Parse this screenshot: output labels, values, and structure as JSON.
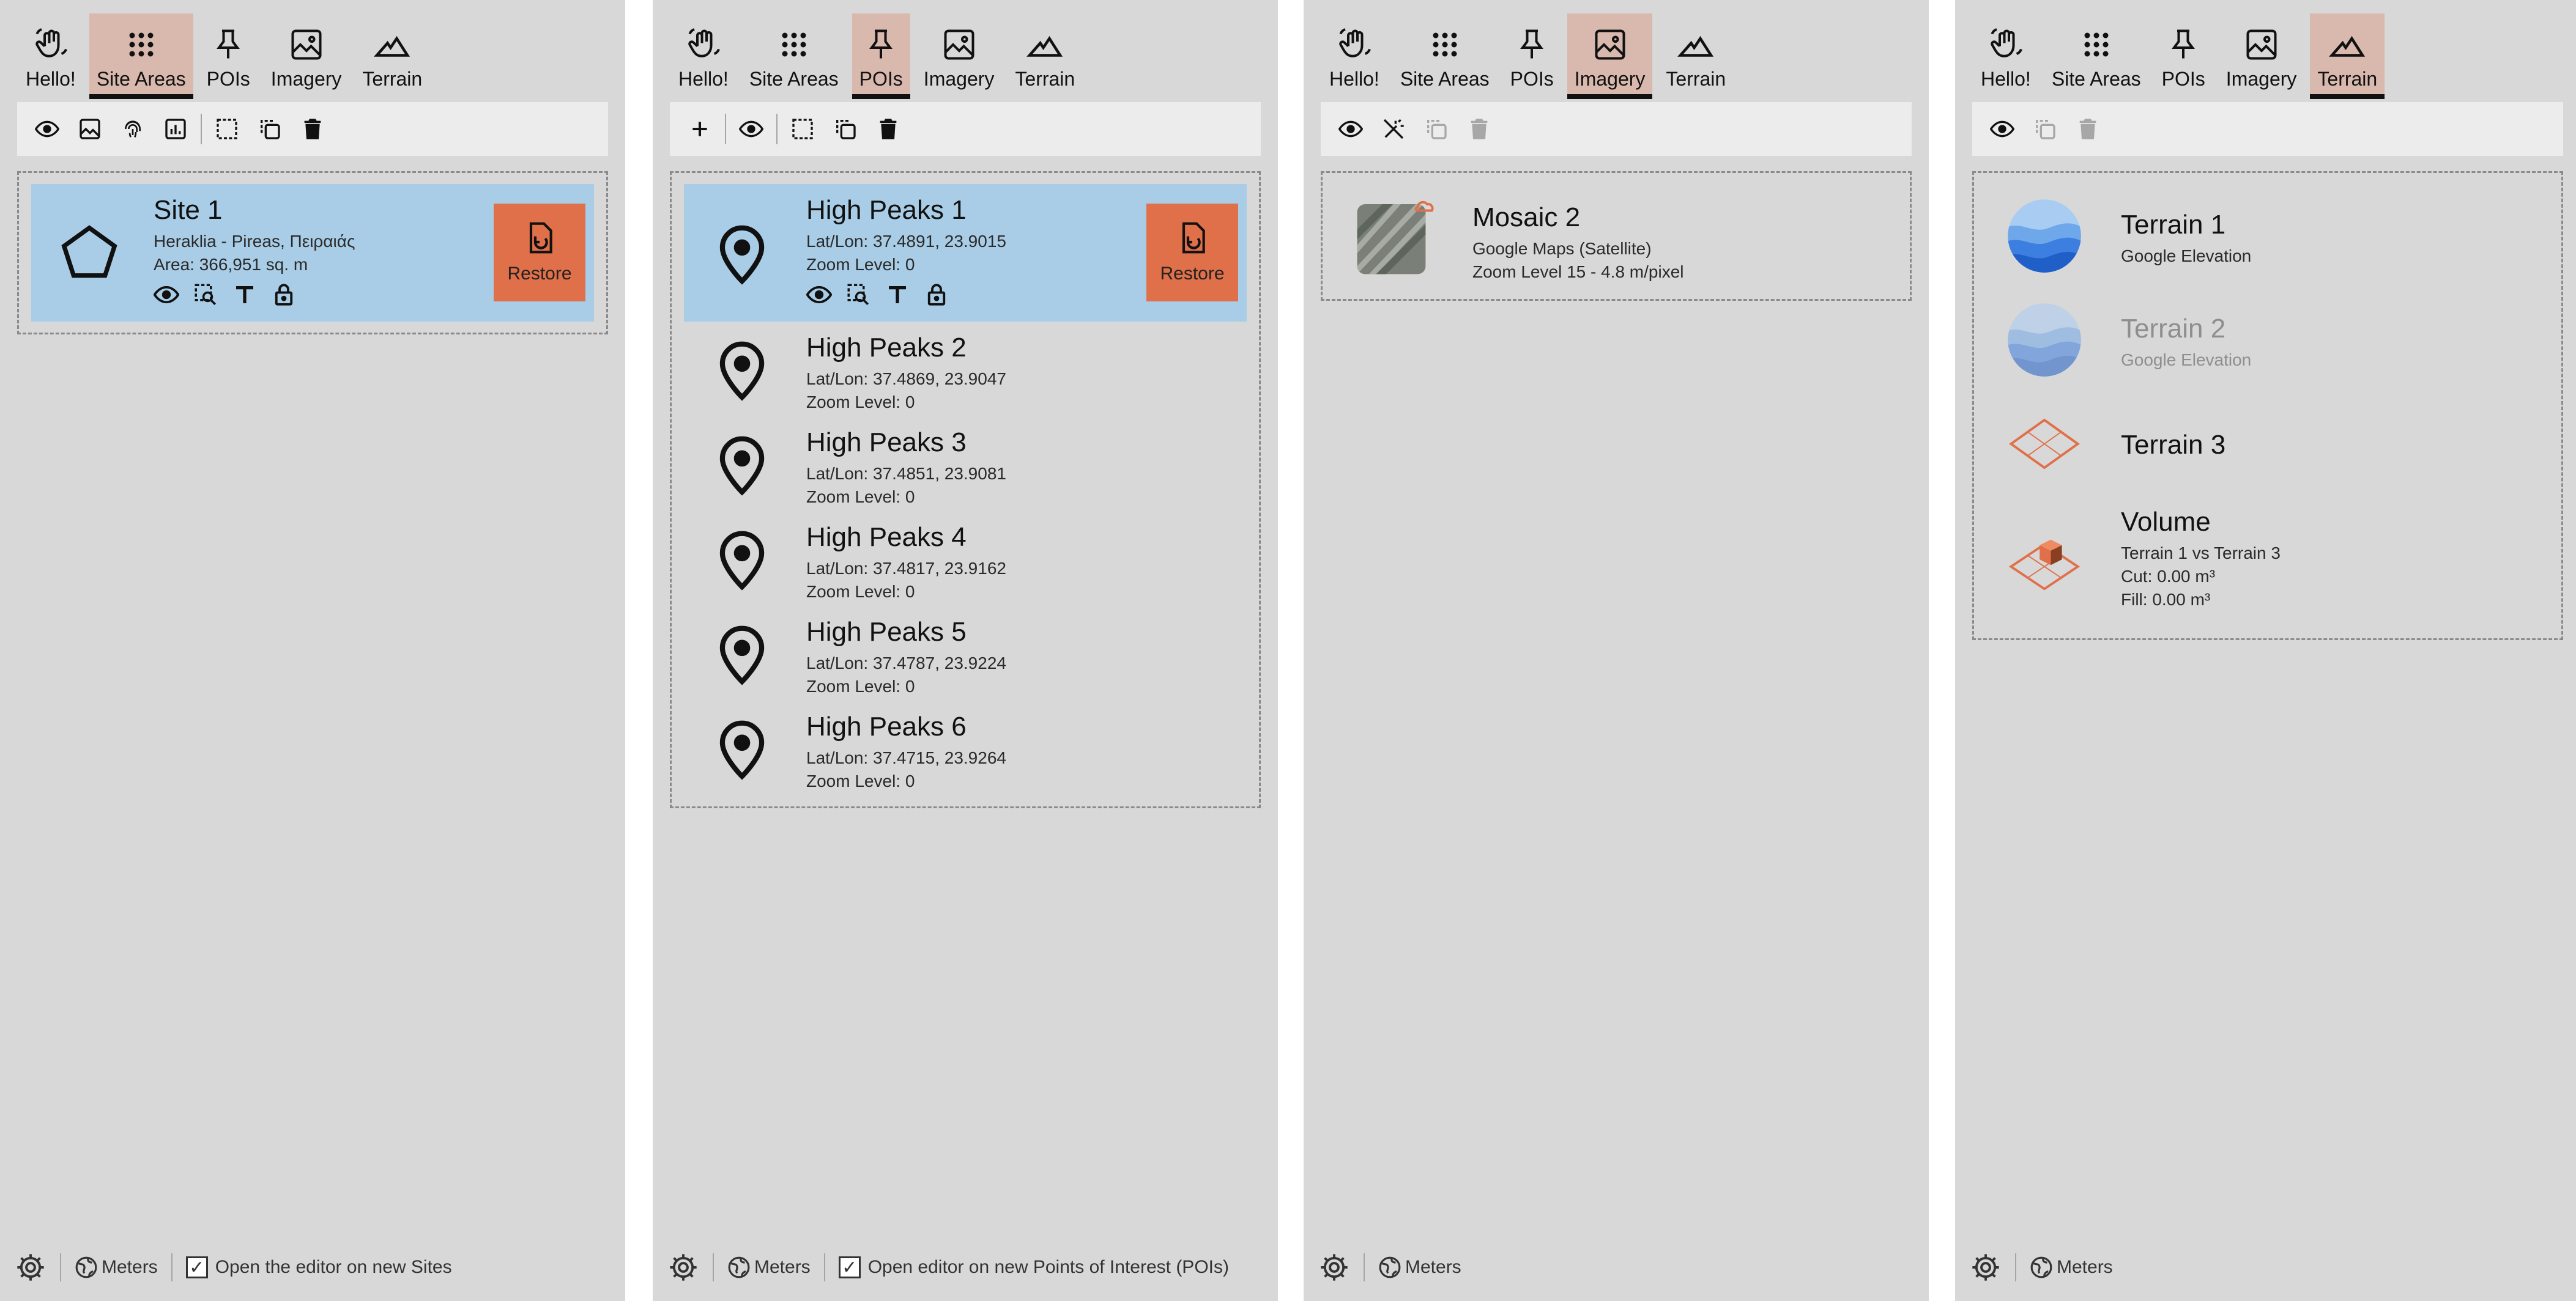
{
  "tabs": [
    {
      "key": "hello",
      "label": "Hello!",
      "icon": "waving-hand-icon"
    },
    {
      "key": "site-areas",
      "label": "Site Areas",
      "icon": "grid-icon"
    },
    {
      "key": "pois",
      "label": "POIs",
      "icon": "pushpin-icon"
    },
    {
      "key": "imagery",
      "label": "Imagery",
      "icon": "image-icon"
    },
    {
      "key": "terrain",
      "label": "Terrain",
      "icon": "mountain-icon"
    }
  ],
  "accent": "#e07049",
  "selected_bg": "#a9cde6",
  "active_tab_bg": "#d9b9ad",
  "panels": {
    "sites": {
      "active_tab": "site-areas",
      "items": [
        {
          "title": "Site 1",
          "line1": "Heraklia - Pireas, Πειραιάς",
          "line2": "Area: 366,951 sq. m",
          "restore_label": "Restore"
        }
      ],
      "footer": {
        "units": "Meters",
        "checkbox_label": "Open the editor on new Sites",
        "checked": true
      }
    },
    "pois": {
      "active_tab": "pois",
      "items": [
        {
          "title": "High Peaks 1",
          "line1": "Lat/Lon: 37.4891, 23.9015",
          "line2": "Zoom Level: 0",
          "restore_label": "Restore"
        },
        {
          "title": "High Peaks 2",
          "line1": "Lat/Lon: 37.4869, 23.9047",
          "line2": "Zoom Level: 0"
        },
        {
          "title": "High Peaks 3",
          "line1": "Lat/Lon: 37.4851, 23.9081",
          "line2": "Zoom Level: 0"
        },
        {
          "title": "High Peaks 4",
          "line1": "Lat/Lon: 37.4817, 23.9162",
          "line2": "Zoom Level: 0"
        },
        {
          "title": "High Peaks 5",
          "line1": "Lat/Lon: 37.4787, 23.9224",
          "line2": "Zoom Level: 0"
        },
        {
          "title": "High Peaks 6",
          "line1": "Lat/Lon: 37.4715, 23.9264",
          "line2": "Zoom Level: 0"
        }
      ],
      "footer": {
        "units": "Meters",
        "checkbox_label": "Open editor on new Points of Interest (POIs)",
        "checked": true
      }
    },
    "imagery": {
      "active_tab": "imagery",
      "items": [
        {
          "title": "Mosaic 2",
          "line1": "Google Maps (Satellite)",
          "line2": "Zoom Level 15 - 4.8 m/pixel"
        }
      ],
      "footer": {
        "units": "Meters"
      }
    },
    "terrain": {
      "active_tab": "terrain",
      "items": [
        {
          "title": "Terrain 1",
          "line1": "Google Elevation"
        },
        {
          "title": "Terrain 2",
          "line1": "Google Elevation"
        },
        {
          "title": "Terrain 3"
        },
        {
          "title": "Volume",
          "line1": "Terrain 1 vs Terrain 3",
          "line2": "Cut: 0.00 m³",
          "line3": "Fill: 0.00 m³"
        }
      ],
      "footer": {
        "units": "Meters"
      }
    }
  }
}
